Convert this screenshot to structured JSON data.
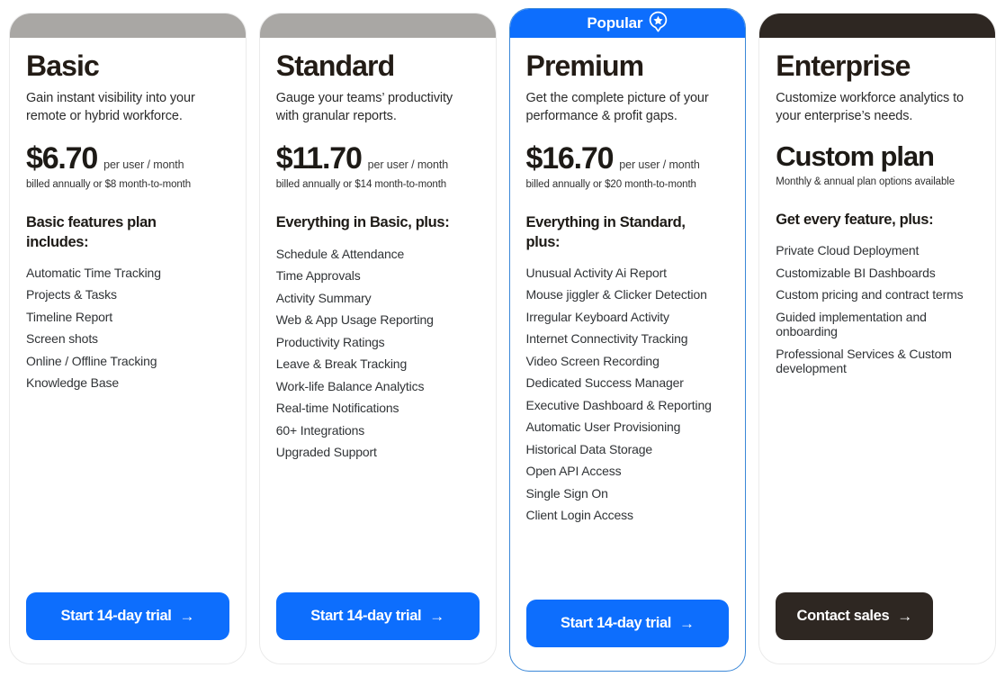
{
  "theme": {
    "accent_blue": "#0d6efd",
    "accent_gray": "#a9a7a4",
    "accent_dark": "#2e2722",
    "featured_border": "#3b88d8",
    "card_border": "#ebebeb",
    "text_dark": "#231c16",
    "text_body": "#303336"
  },
  "plans": [
    {
      "id": "basic",
      "name": "Basic",
      "accent": "gray",
      "badge": null,
      "tagline": "Gain instant visibility into your remote or hybrid workforce.",
      "price": "$6.70",
      "price_unit": "per user / month",
      "billing_note": "billed annually or $8 month-to-month",
      "features_heading": "Basic features plan includes:",
      "features": [
        "Automatic Time Tracking",
        "Projects & Tasks",
        "Timeline Report",
        "Screen shots",
        "Online / Offline Tracking",
        "Knowledge Base"
      ],
      "cta_label": "Start 14-day trial",
      "cta_arrow": "→",
      "cta_style": "blue"
    },
    {
      "id": "standard",
      "name": "Standard",
      "accent": "gray",
      "badge": null,
      "tagline": "Gauge your teams’ productivity with granular reports.",
      "price": "$11.70",
      "price_unit": "per user / month",
      "billing_note": "billed annually or $14 month-to-month",
      "features_heading": "Everything in Basic, plus:",
      "features": [
        "Schedule & Attendance",
        "Time Approvals",
        "Activity Summary",
        "Web & App Usage Reporting",
        "Productivity Ratings",
        "Leave & Break Tracking",
        "Work-life Balance Analytics",
        "Real-time Notifications",
        "60+ Integrations",
        "Upgraded Support"
      ],
      "cta_label": "Start 14-day trial",
      "cta_arrow": "→",
      "cta_style": "blue"
    },
    {
      "id": "premium",
      "name": "Premium",
      "accent": "blue",
      "badge": "Popular",
      "badge_icon": "star-pin-icon",
      "tagline": "Get the complete picture of your performance & profit gaps.",
      "price": "$16.70",
      "price_unit": "per user / month",
      "billing_note": "billed annually or $20 month-to-month",
      "features_heading": "Everything in Standard, plus:",
      "features": [
        "Unusual Activity Ai Report",
        "Mouse jiggler & Clicker Detection",
        "Irregular Keyboard Activity",
        "Internet Connectivity Tracking",
        "Video Screen Recording",
        "Dedicated Success Manager",
        "Executive Dashboard & Reporting",
        "Automatic User Provisioning",
        "Historical Data Storage",
        "Open API Access",
        "Single Sign On",
        "Client Login Access"
      ],
      "cta_label": "Start 14-day trial",
      "cta_arrow": "→",
      "cta_style": "blue"
    },
    {
      "id": "enterprise",
      "name": "Enterprise",
      "accent": "dark",
      "badge": null,
      "tagline": "Customize workforce analytics to your enterprise’s needs.",
      "price": "Custom plan",
      "price_unit": "",
      "billing_note": "Monthly & annual plan options available",
      "features_heading": "Get every feature, plus:",
      "features": [
        "Private Cloud Deployment",
        "Customizable BI Dashboards",
        "Custom pricing and contract terms",
        "Guided implementation and onboarding",
        "Professional Services & Custom development"
      ],
      "cta_label": "Contact sales",
      "cta_arrow": "→",
      "cta_style": "dark"
    }
  ]
}
